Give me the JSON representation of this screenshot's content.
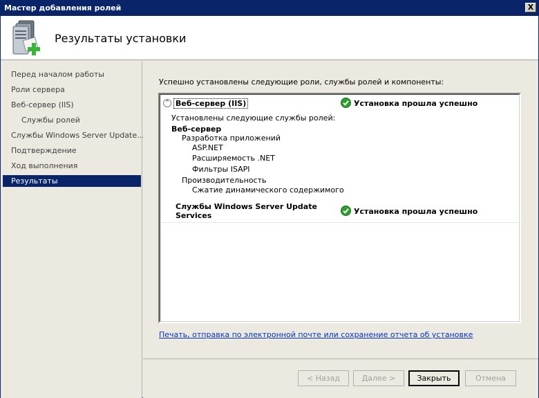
{
  "window": {
    "title": "Мастер добавления ролей",
    "close_label": "X"
  },
  "header": {
    "title": "Результаты установки",
    "icon": "server-add-icon"
  },
  "sidebar": {
    "items": [
      {
        "label": "Перед началом работы"
      },
      {
        "label": "Роли сервера"
      },
      {
        "label": "Веб-сервер (IIS)"
      },
      {
        "label": "Службы ролей"
      },
      {
        "label": "Службы Windows Server Update..."
      },
      {
        "label": "Подтверждение"
      },
      {
        "label": "Ход выполнения"
      },
      {
        "label": "Результаты"
      }
    ]
  },
  "main": {
    "intro": "Успешно установлены следующие роли, службы ролей и компоненты:",
    "collapse_glyph": "⌃",
    "roles": [
      {
        "name": "Веб-сервер (IIS)",
        "status": "Установка прошла успешно",
        "details": {
          "installed_label": "Установлены следующие службы ролей:",
          "group": "Веб-сервер",
          "sub1": "Разработка приложений",
          "sub1_items": [
            "ASP.NET",
            "Расширяемость .NET",
            "Фильтры ISAPI"
          ],
          "sub2": "Производительность",
          "sub2_items": [
            "Сжатие динамического содержимого"
          ]
        }
      },
      {
        "name_line1": "Службы Windows Server Update",
        "name_line2": "Services",
        "status": "Установка прошла успешно"
      }
    ],
    "report_link": "Печать, отправка по электронной почте или сохранение отчета об установке"
  },
  "footer": {
    "back": "< Назад",
    "next": "Далее >",
    "close": "Закрыть",
    "cancel": "Отмена"
  },
  "colors": {
    "titlebar": "#0a246a",
    "success_green": "#2e9e2e",
    "link": "#0033cc"
  }
}
